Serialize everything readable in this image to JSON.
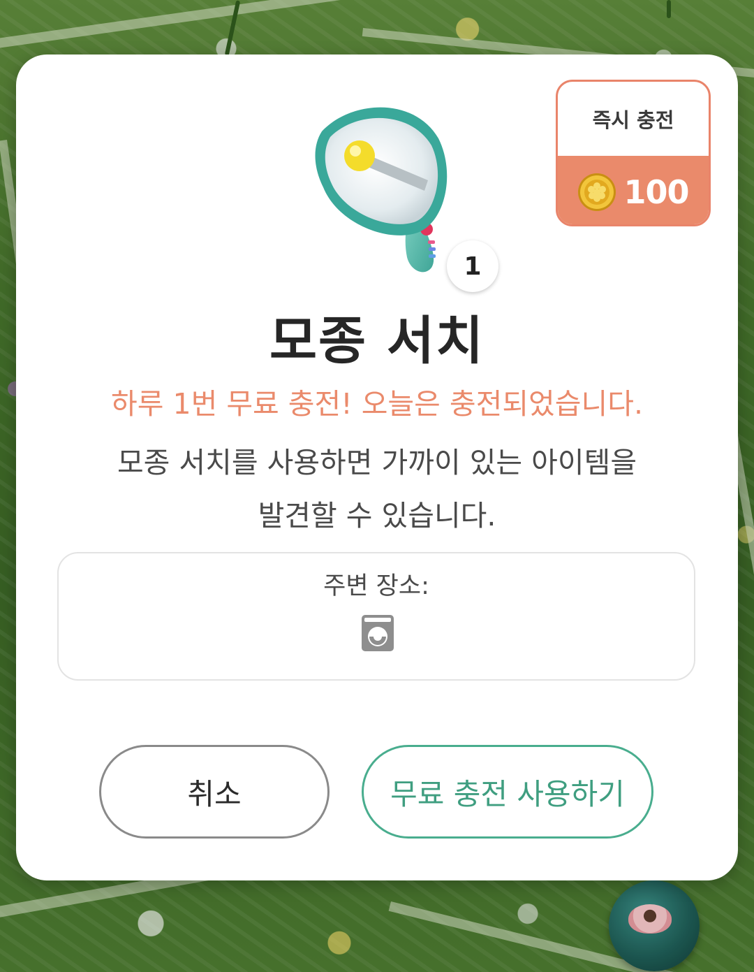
{
  "dialog": {
    "item": {
      "icon": "megaphone-icon",
      "count": "1"
    },
    "instant_charge": {
      "label": "즉시 충전",
      "currency_icon": "gold-coin-icon",
      "price": "100"
    },
    "title": "모종 서치",
    "free_charge_notice": "하루 1번 무료 충전! 오늘은 충전되었습니다.",
    "description_line1": "모종 서치를 사용하면 가까이 있는 아이템을",
    "description_line2": "발견할 수 있습니다.",
    "nearby": {
      "label": "주변 장소:",
      "place_icon": "washing-machine-icon"
    },
    "buttons": {
      "cancel": "취소",
      "use_free_charge": "무료 충전 사용하기"
    }
  },
  "colors": {
    "accent_orange": "#ea8a6b",
    "accent_green": "#49ad8e",
    "title_text": "#262626",
    "body_text": "#4a4a4a"
  }
}
